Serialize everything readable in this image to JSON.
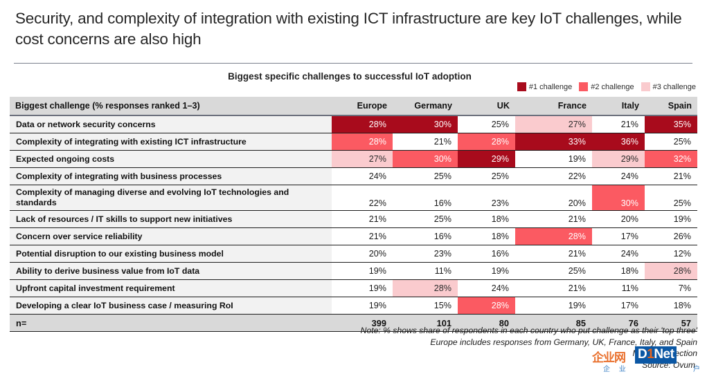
{
  "title": "Security, and complexity of integration with existing ICT infrastructure are key IoT challenges, while cost concerns are also high",
  "subtitle": "Biggest specific challenges to successful IoT adoption",
  "legend": {
    "items": [
      {
        "label": "#1 challenge",
        "color": "#a80b1c"
      },
      {
        "label": "#2 challenge",
        "color": "#fb5a62"
      },
      {
        "label": "#3 challenge",
        "color": "#facbce"
      }
    ]
  },
  "notes": {
    "line1": "Note: % shows share of respondents in each country who put challenge as their 'top three'",
    "line2": "Europe includes responses from Germany, UK, France, Italy, and Spain",
    "line3": "Multiple selection",
    "source": "Source: Ovum"
  },
  "watermark": {
    "cn": "企业网",
    "d1_pre": "D",
    "d1_num": "1",
    "d1_post": "Net",
    "sub": "企 业",
    "sub2": "户"
  },
  "chart_data": {
    "type": "heatmap",
    "title": "Biggest specific challenges to successful IoT adoption",
    "xlabel": "",
    "ylabel": "",
    "row_header": "Biggest challenge (% responses ranked 1–3)",
    "categories": [
      "Europe",
      "Germany",
      "UK",
      "France",
      "Italy",
      "Spain"
    ],
    "legend": [
      "#1 challenge",
      "#2 challenge",
      "#3 challenge"
    ],
    "rank_colors": {
      "1": "#a80b1c",
      "2": "#fb5a62",
      "3": "#facbce",
      "0": "#ffffff"
    },
    "rows": [
      {
        "label": "Data or network security concerns",
        "values": [
          "28%",
          "30%",
          "25%",
          "27%",
          "21%",
          "35%"
        ],
        "ranks": [
          1,
          1,
          0,
          3,
          0,
          1
        ]
      },
      {
        "label": "Complexity of integrating with existing ICT infrastructure",
        "values": [
          "28%",
          "21%",
          "28%",
          "33%",
          "36%",
          "25%"
        ],
        "ranks": [
          2,
          0,
          2,
          1,
          1,
          0
        ]
      },
      {
        "label": "Expected ongoing costs",
        "values": [
          "27%",
          "30%",
          "29%",
          "19%",
          "29%",
          "32%"
        ],
        "ranks": [
          3,
          2,
          1,
          0,
          3,
          2
        ]
      },
      {
        "label": "Complexity of integrating with business processes",
        "values": [
          "24%",
          "25%",
          "25%",
          "22%",
          "24%",
          "21%"
        ],
        "ranks": [
          0,
          0,
          0,
          0,
          0,
          0
        ]
      },
      {
        "label": "Complexity of managing diverse and evolving IoT technologies and standards",
        "values": [
          "22%",
          "16%",
          "23%",
          "20%",
          "30%",
          "25%"
        ],
        "ranks": [
          0,
          0,
          0,
          0,
          2,
          0
        ],
        "tall": true
      },
      {
        "label": "Lack of resources / IT skills to support new initiatives",
        "values": [
          "21%",
          "25%",
          "18%",
          "21%",
          "20%",
          "19%"
        ],
        "ranks": [
          0,
          0,
          0,
          0,
          0,
          0
        ]
      },
      {
        "label": "Concern over service reliability",
        "values": [
          "21%",
          "16%",
          "18%",
          "28%",
          "17%",
          "26%"
        ],
        "ranks": [
          0,
          0,
          0,
          2,
          0,
          0
        ]
      },
      {
        "label": "Potential disruption to our existing business model",
        "values": [
          "20%",
          "23%",
          "16%",
          "21%",
          "24%",
          "12%"
        ],
        "ranks": [
          0,
          0,
          0,
          0,
          0,
          0
        ]
      },
      {
        "label": "Ability to derive business value from IoT data",
        "values": [
          "19%",
          "11%",
          "19%",
          "25%",
          "18%",
          "28%"
        ],
        "ranks": [
          0,
          0,
          0,
          0,
          0,
          3
        ]
      },
      {
        "label": "Upfront capital investment requirement",
        "values": [
          "19%",
          "28%",
          "24%",
          "21%",
          "11%",
          "7%"
        ],
        "ranks": [
          0,
          3,
          0,
          0,
          0,
          0
        ]
      },
      {
        "label": "Developing a clear IoT business case / measuring RoI",
        "values": [
          "19%",
          "15%",
          "28%",
          "19%",
          "17%",
          "18%"
        ],
        "ranks": [
          0,
          0,
          2,
          0,
          0,
          0
        ]
      }
    ],
    "n_label": "n=",
    "n_values": [
      "399",
      "101",
      "80",
      "85",
      "76",
      "57"
    ]
  }
}
